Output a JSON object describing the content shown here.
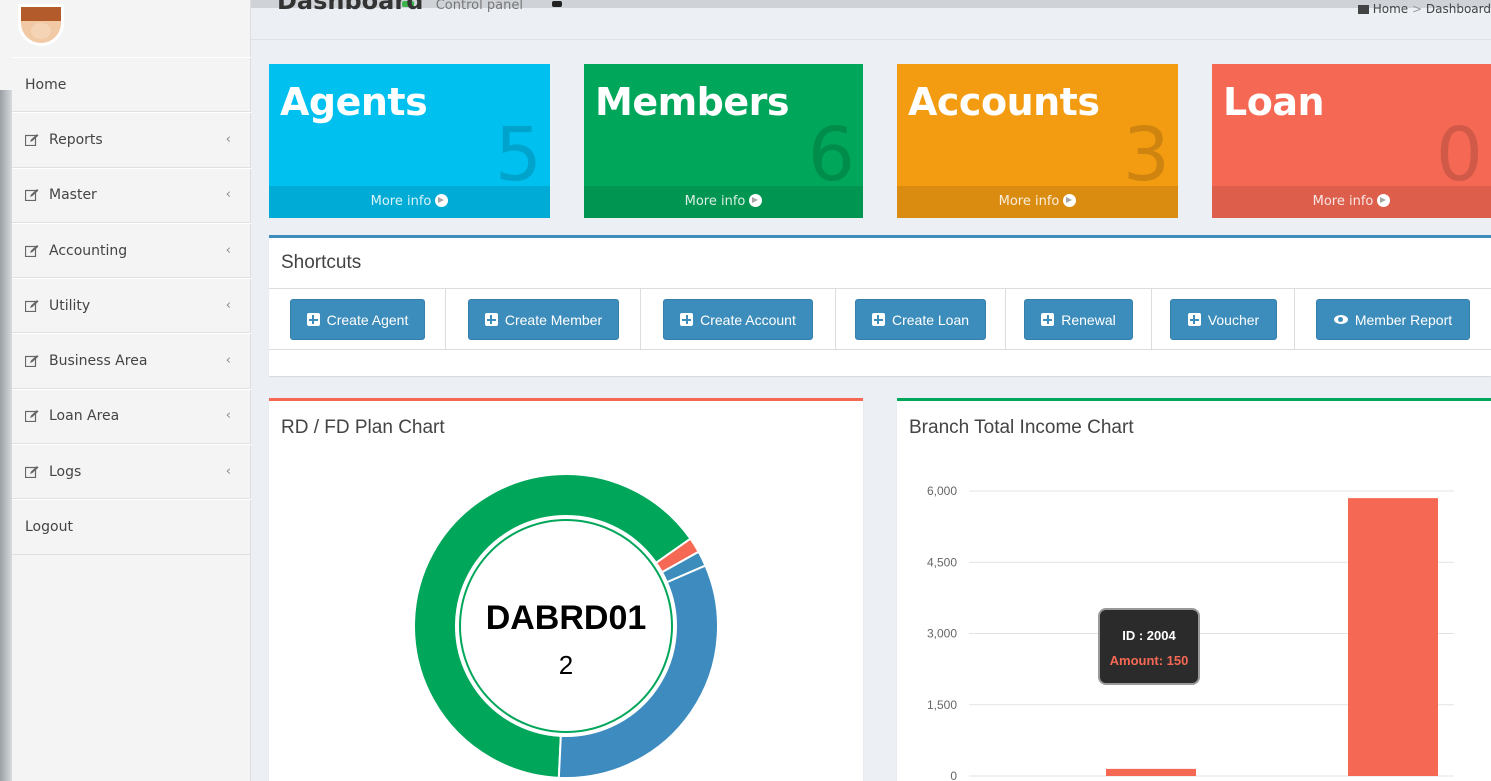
{
  "header": {
    "title": "Dashboard",
    "subtitle": "Control panel",
    "breadcrumb": [
      "Home",
      ">",
      "Dashboard"
    ]
  },
  "sidebar": {
    "items": [
      {
        "label": "Home",
        "icon": "",
        "has_chevron": false
      },
      {
        "label": "Reports",
        "icon": "edit-icon",
        "has_chevron": true
      },
      {
        "label": "Master",
        "icon": "edit-icon",
        "has_chevron": true
      },
      {
        "label": "Accounting",
        "icon": "edit-icon",
        "has_chevron": true
      },
      {
        "label": "Utility",
        "icon": "edit-icon",
        "has_chevron": true
      },
      {
        "label": "Business Area",
        "icon": "edit-icon",
        "has_chevron": true
      },
      {
        "label": "Loan Area",
        "icon": "edit-icon",
        "has_chevron": true
      },
      {
        "label": "Logs",
        "icon": "edit-icon",
        "has_chevron": true
      },
      {
        "label": "Logout",
        "icon": "",
        "has_chevron": false
      }
    ],
    "chevron": "‹"
  },
  "stats": [
    {
      "label": "Agents",
      "count": "5",
      "footer": "More info",
      "color": "#00c0ef"
    },
    {
      "label": "Members",
      "count": "6",
      "footer": "More info",
      "color": "#00a65a"
    },
    {
      "label": "Accounts",
      "count": "3",
      "footer": "More info",
      "color": "#f39c12"
    },
    {
      "label": "Loan",
      "count": "0",
      "footer": "More info",
      "color": "#f56954"
    }
  ],
  "shortcuts": {
    "title": "Shortcuts",
    "buttons": [
      {
        "label": "Create Agent",
        "icon": "plus-square-icon"
      },
      {
        "label": "Create Member",
        "icon": "plus-square-icon"
      },
      {
        "label": "Create Account",
        "icon": "plus-square-icon"
      },
      {
        "label": "Create Loan",
        "icon": "plus-square-icon"
      },
      {
        "label": "Renewal",
        "icon": "plus-square-icon"
      },
      {
        "label": "Voucher",
        "icon": "plus-square-icon"
      },
      {
        "label": "Member Report",
        "icon": "eye-icon"
      }
    ]
  },
  "donut_panel": {
    "title": "RD / FD Plan Chart",
    "center_label": "DABRD01",
    "center_value": "2"
  },
  "bar_panel": {
    "title": "Branch Total Income Chart",
    "tooltip_id": "ID : 2004",
    "tooltip_amount": "Amount: 150"
  },
  "colors": {
    "primary": "#3c8dbc",
    "aqua": "#00c0ef",
    "green": "#00a65a",
    "yellow": "#f39c12",
    "red": "#f56954",
    "blue_slice": "#3d8bbf"
  },
  "chart_data": [
    {
      "type": "pie",
      "title": "RD / FD Plan Chart",
      "labels": [
        "DABRD01",
        "",
        "",
        ""
      ],
      "values": [
        2,
        0.05,
        0.05,
        1
      ],
      "colors": [
        "#00a65a",
        "#f56954",
        "#3c8dbc",
        "#3d8bbf"
      ]
    },
    {
      "type": "bar",
      "title": "Branch Total Income Chart",
      "categories": [
        "2004",
        ""
      ],
      "values": [
        150,
        5850
      ],
      "ylim": [
        0,
        6000
      ],
      "yticks": [
        "0",
        "1,500",
        "3,000",
        "4,500",
        "6,000"
      ],
      "grid": true,
      "color": "#f56954"
    }
  ]
}
